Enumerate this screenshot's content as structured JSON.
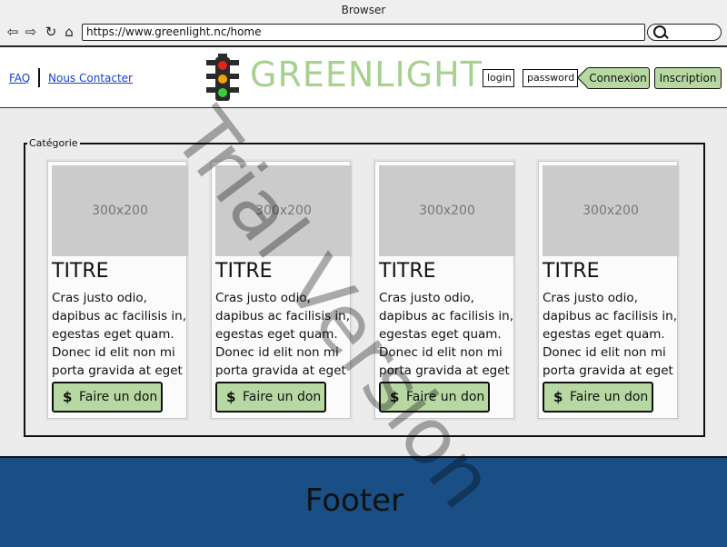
{
  "browser": {
    "title": "Browser",
    "url": "https://www.greenlight.nc/home"
  },
  "header": {
    "faq": "FAQ",
    "contact": "Nous Contacter",
    "brand": "GREENLIGHT",
    "login_placeholder": "login",
    "password_placeholder": "password",
    "connexion": "Connexion",
    "inscription": "Inscription"
  },
  "category": {
    "legend": "Catégorie",
    "cards": [
      {
        "image": "300x200",
        "title": "TITRE",
        "text": "Cras justo odio, dapibus ac facilisis in, egestas eget quam. Donec id elit non mi porta gravida at eget",
        "button_icon": "$",
        "button": "Faire un don"
      },
      {
        "image": "300x200",
        "title": "TITRE",
        "text": "Cras justo odio, dapibus ac facilisis in, egestas eget quam. Donec id elit non mi porta gravida at eget",
        "button_icon": "$",
        "button": "Faire un don"
      },
      {
        "image": "300x200",
        "title": "TITRE",
        "text": "Cras justo odio, dapibus ac facilisis in, egestas eget quam. Donec id elit non mi porta gravida at eget",
        "button_icon": "$",
        "button": "Faire un don"
      },
      {
        "image": "300x200",
        "title": "TITRE",
        "text": "Cras justo odio, dapibus ac facilisis in, egestas eget quam. Donec id elit non mi porta gravida at eget",
        "button_icon": "$",
        "button": "Faire un don"
      }
    ]
  },
  "footer": {
    "text": "Footer"
  },
  "watermark": "Trial Version",
  "icons": {
    "back": "back-arrow-icon",
    "forward": "forward-arrow-icon",
    "reload": "reload-icon",
    "home": "home-icon",
    "search": "search-icon",
    "logo": "traffic-light-icon",
    "dollar": "dollar-icon"
  },
  "colors": {
    "brand": "#a7d18f",
    "button": "#b7d8a2",
    "footer": "#1a4f86",
    "link": "#1a3fd0",
    "light_red": "#e0261b",
    "light_amber": "#f0a30a",
    "light_green": "#35d13a"
  }
}
